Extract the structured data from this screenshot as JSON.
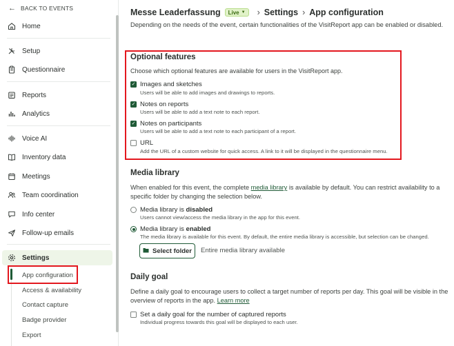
{
  "sidebar": {
    "back_label": "BACK TO EVENTS",
    "items": [
      {
        "label": "Home",
        "icon": "home-icon"
      },
      {
        "label": "Setup",
        "icon": "tools-icon"
      },
      {
        "label": "Questionnaire",
        "icon": "clipboard-icon"
      },
      {
        "label": "Reports",
        "icon": "reports-icon"
      },
      {
        "label": "Analytics",
        "icon": "bar-chart-icon"
      },
      {
        "label": "Voice AI",
        "icon": "voice-wave-icon"
      },
      {
        "label": "Inventory data",
        "icon": "book-icon"
      },
      {
        "label": "Meetings",
        "icon": "calendar-icon"
      },
      {
        "label": "Team coordination",
        "icon": "team-icon"
      },
      {
        "label": "Info center",
        "icon": "chat-bubble-icon"
      },
      {
        "label": "Follow-up emails",
        "icon": "send-icon"
      },
      {
        "label": "Settings",
        "icon": "settings-gear-icon"
      }
    ],
    "sub_items": [
      "App configuration",
      "Access & availability",
      "Contact capture",
      "Badge provider",
      "Export"
    ]
  },
  "header": {
    "event_name": "Messe Leaderfassung",
    "status_badge": "Live",
    "crumb_settings": "Settings",
    "crumb_current": "App configuration"
  },
  "intro": "Depending on the needs of the event, certain functionalities of the VisitReport app can be enabled or disabled.",
  "optional_features": {
    "title": "Optional features",
    "subtitle": "Choose which optional features are available for users in the VisitReport app.",
    "options": [
      {
        "label": "Images and sketches",
        "description": "Users will be able to add images and drawings to reports.",
        "checked": true
      },
      {
        "label": "Notes on reports",
        "description": "Users will be able to add a text note to each report.",
        "checked": true
      },
      {
        "label": "Notes on participants",
        "description": "Users will be able to add a text note to each participant of a report.",
        "checked": true
      },
      {
        "label": "URL",
        "description": "Add the URL of a custom website for quick access. A link to it will be displayed in the questionnaire menu.",
        "checked": false
      }
    ]
  },
  "media_library": {
    "title": "Media library",
    "desc_before": "When enabled for this event, the complete ",
    "desc_link": "media library",
    "desc_after": " is available by default. You can restrict availability to a specific folder by changing the selection below.",
    "option_disabled_prefix": "Media library is ",
    "option_disabled_state": "disabled",
    "option_disabled_desc": "Users cannot view/access the media library in the app for this event.",
    "option_enabled_prefix": "Media library is ",
    "option_enabled_state": "enabled",
    "option_enabled_desc": "The media library is available for this event. By default, the entire media library is accessible, but selection can be changed.",
    "selected": "enabled",
    "select_folder_label": "Select folder",
    "selection_note": "Entire media library available"
  },
  "daily_goal": {
    "title": "Daily goal",
    "desc": "Define a daily goal to encourage users to collect a target number of reports per day. This goal will be visible in the overview of reports in the app.",
    "desc_link": "Learn more",
    "checkbox_label": "Set a daily goal for the number of captured reports",
    "checkbox_desc": "Individual progress towards this goal will be displayed to each user.",
    "checked": false
  },
  "colors": {
    "accent": "#1f5a36",
    "active_bg": "#eef5e8",
    "highlight_box": "#e3161d",
    "live_badge": "#e1f2c9"
  }
}
